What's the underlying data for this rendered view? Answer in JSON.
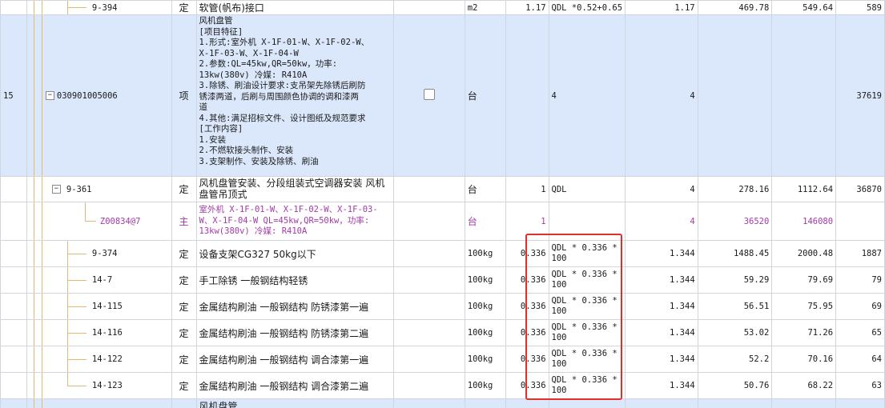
{
  "rows": [
    {
      "seq": "",
      "code": "9-394",
      "type": "定",
      "desc_lines": [
        "软管(帆布)接口"
      ],
      "unit": "m2",
      "coef": "1.17",
      "expr": "QDL *0.52+0.65",
      "qty": "1.17",
      "price": "469.78",
      "amount": "549.64",
      "extra": "589"
    },
    {
      "seq": "15",
      "code": "030901005006",
      "type": "项",
      "desc_lines": [
        "风机盘管",
        "[项目特征]",
        "1.形式:室外机 X-1F-01-W、X-1F-02-W、",
        "X-1F-03-W、X-1F-04-W",
        "2.参数:QL=45kw,QR=50kw，功率:",
        "13kw(380v) 冷媒: R410A",
        "3.除锈、刷油设计要求:支吊架先除锈后刷防",
        "锈漆两道，后刷与周围颜色协调的调和漆两",
        "道",
        "4.其他:满足招标文件、设计图纸及规范要求",
        "[工作内容]",
        "1.安装",
        "2.不燃软接头制作、安装",
        "3.支架制作、安装及除锈、刷油"
      ],
      "unit": "台",
      "coef": "",
      "expr": "4",
      "qty": "4",
      "price": "",
      "amount": "",
      "extra": "37619"
    },
    {
      "seq": "",
      "code": "9-361",
      "type": "定",
      "desc_lines": [
        "风机盘管安装、分段组装式空调器安装 风机",
        "盘管吊顶式"
      ],
      "unit": "台",
      "coef": "1",
      "expr": "QDL",
      "qty": "4",
      "price": "278.16",
      "amount": "1112.64",
      "extra": "36870"
    },
    {
      "seq": "",
      "code": "Z00834@7",
      "type": "主",
      "desc_lines": [
        "室外机 X-1F-01-W、X-1F-02-W、X-1F-03-",
        "W、X-1F-04-W QL=45kw,QR=50kw，功率:",
        "13kw(380v) 冷媒: R410A"
      ],
      "unit": "台",
      "coef": "1",
      "expr": "",
      "qty": "4",
      "price": "36520",
      "amount": "146080",
      "extra": ""
    },
    {
      "seq": "",
      "code": "9-374",
      "type": "定",
      "desc_lines": [
        "设备支架CG327 50kg以下"
      ],
      "unit": "100kg",
      "coef": "0.336",
      "expr": "QDL * 0.336 * 100",
      "qty": "1.344",
      "price": "1488.45",
      "amount": "2000.48",
      "extra": "1887"
    },
    {
      "seq": "",
      "code": "14-7",
      "type": "定",
      "desc_lines": [
        "手工除锈 一般钢结构轻锈"
      ],
      "unit": "100kg",
      "coef": "0.336",
      "expr": "QDL * 0.336 * 100",
      "qty": "1.344",
      "price": "59.29",
      "amount": "79.69",
      "extra": "79"
    },
    {
      "seq": "",
      "code": "14-115",
      "type": "定",
      "desc_lines": [
        "金属结构刷油 一般钢结构 防锈漆第一遍"
      ],
      "unit": "100kg",
      "coef": "0.336",
      "expr": "QDL * 0.336 * 100",
      "qty": "1.344",
      "price": "56.51",
      "amount": "75.95",
      "extra": "69"
    },
    {
      "seq": "",
      "code": "14-116",
      "type": "定",
      "desc_lines": [
        "金属结构刷油 一般钢结构 防锈漆第二遍"
      ],
      "unit": "100kg",
      "coef": "0.336",
      "expr": "QDL * 0.336 * 100",
      "qty": "1.344",
      "price": "53.02",
      "amount": "71.26",
      "extra": "65"
    },
    {
      "seq": "",
      "code": "14-122",
      "type": "定",
      "desc_lines": [
        "金属结构刷油 一般钢结构 调合漆第一遍"
      ],
      "unit": "100kg",
      "coef": "0.336",
      "expr": "QDL * 0.336 * 100",
      "qty": "1.344",
      "price": "52.2",
      "amount": "70.16",
      "extra": "64"
    },
    {
      "seq": "",
      "code": "14-123",
      "type": "定",
      "desc_lines": [
        "金属结构刷油 一般钢结构 调合漆第二遍"
      ],
      "unit": "100kg",
      "coef": "0.336",
      "expr": "QDL * 0.336 * 100",
      "qty": "1.344",
      "price": "50.76",
      "amount": "68.22",
      "extra": "63"
    },
    {
      "seq": "",
      "code": "",
      "type": "",
      "desc_lines": [
        "风机盘管"
      ],
      "unit": "",
      "coef": "",
      "expr": "",
      "qty": "",
      "price": "",
      "amount": "",
      "extra": ""
    }
  ],
  "colors": {
    "highlight": "#dbe8fb",
    "main_material": "#a43aa8",
    "annotation_box": "#e0302c",
    "tree_line": "#e3b776"
  }
}
